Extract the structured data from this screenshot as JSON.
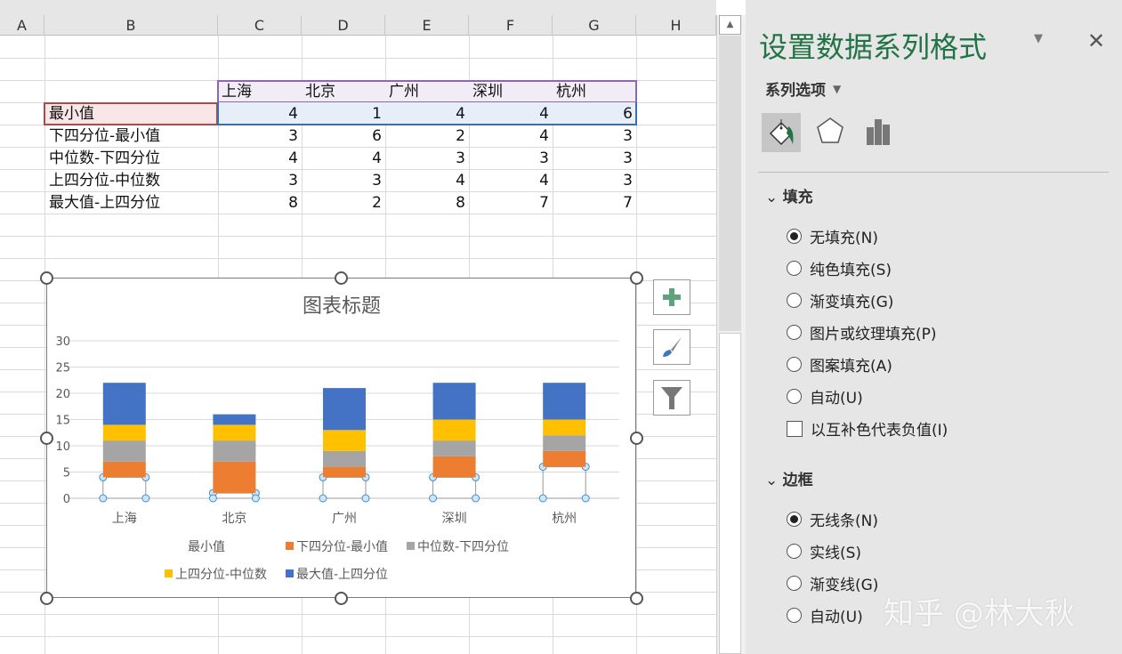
{
  "sheet": {
    "columns": [
      "A",
      "B",
      "C",
      "D",
      "E",
      "F",
      "G",
      "H"
    ],
    "table": {
      "headers": [
        "上海",
        "北京",
        "广州",
        "深圳",
        "杭州"
      ],
      "rows": [
        {
          "label": "最小值",
          "values": [
            4,
            1,
            4,
            4,
            6
          ]
        },
        {
          "label": "下四分位-最小值",
          "values": [
            3,
            6,
            2,
            4,
            3
          ]
        },
        {
          "label": "中位数-下四分位",
          "values": [
            4,
            4,
            3,
            3,
            3
          ]
        },
        {
          "label": "上四分位-中位数",
          "values": [
            3,
            3,
            4,
            4,
            3
          ]
        },
        {
          "label": "最大值-上四分位",
          "values": [
            8,
            2,
            8,
            7,
            7
          ]
        }
      ]
    }
  },
  "chart_data": {
    "type": "bar",
    "stacked": true,
    "title": "图表标题",
    "categories": [
      "上海",
      "北京",
      "广州",
      "深圳",
      "杭州"
    ],
    "ylim": [
      0,
      30
    ],
    "yticks": [
      0,
      5,
      10,
      15,
      20,
      25,
      30
    ],
    "grid": true,
    "legend_position": "bottom",
    "series": [
      {
        "name": "最小值",
        "values": [
          4,
          1,
          4,
          4,
          6
        ],
        "color": "none"
      },
      {
        "name": "下四分位-最小值",
        "values": [
          3,
          6,
          2,
          4,
          3
        ],
        "color": "#ED7D31"
      },
      {
        "name": "中位数-下四分位",
        "values": [
          4,
          4,
          3,
          3,
          3
        ],
        "color": "#A5A5A5"
      },
      {
        "name": "上四分位-中位数",
        "values": [
          3,
          3,
          4,
          4,
          3
        ],
        "color": "#FFC000"
      },
      {
        "name": "最大值-上四分位",
        "values": [
          8,
          2,
          8,
          7,
          7
        ],
        "color": "#4472C4"
      }
    ]
  },
  "chart_buttons": {
    "icons": [
      "plus-icon",
      "brush-icon",
      "filter-icon"
    ]
  },
  "panel": {
    "title": "设置数据系列格式",
    "series_options": "系列选项",
    "fill_section": "填充",
    "fill_options": [
      {
        "label": "无填充(N)",
        "checked": true
      },
      {
        "label": "纯色填充(S)",
        "checked": false
      },
      {
        "label": "渐变填充(G)",
        "checked": false
      },
      {
        "label": "图片或纹理填充(P)",
        "checked": false
      },
      {
        "label": "图案填充(A)",
        "checked": false
      },
      {
        "label": "自动(U)",
        "checked": false
      }
    ],
    "invert_label": "以互补色代表负值(I)",
    "border_section": "边框",
    "border_options": [
      {
        "label": "无线条(N)",
        "checked": true
      },
      {
        "label": "实线(S)",
        "checked": false
      },
      {
        "label": "渐变线(G)",
        "checked": false
      },
      {
        "label": "自动(U)",
        "checked": false
      }
    ],
    "accent": "#217346"
  },
  "watermark": "知乎 @林大秋"
}
